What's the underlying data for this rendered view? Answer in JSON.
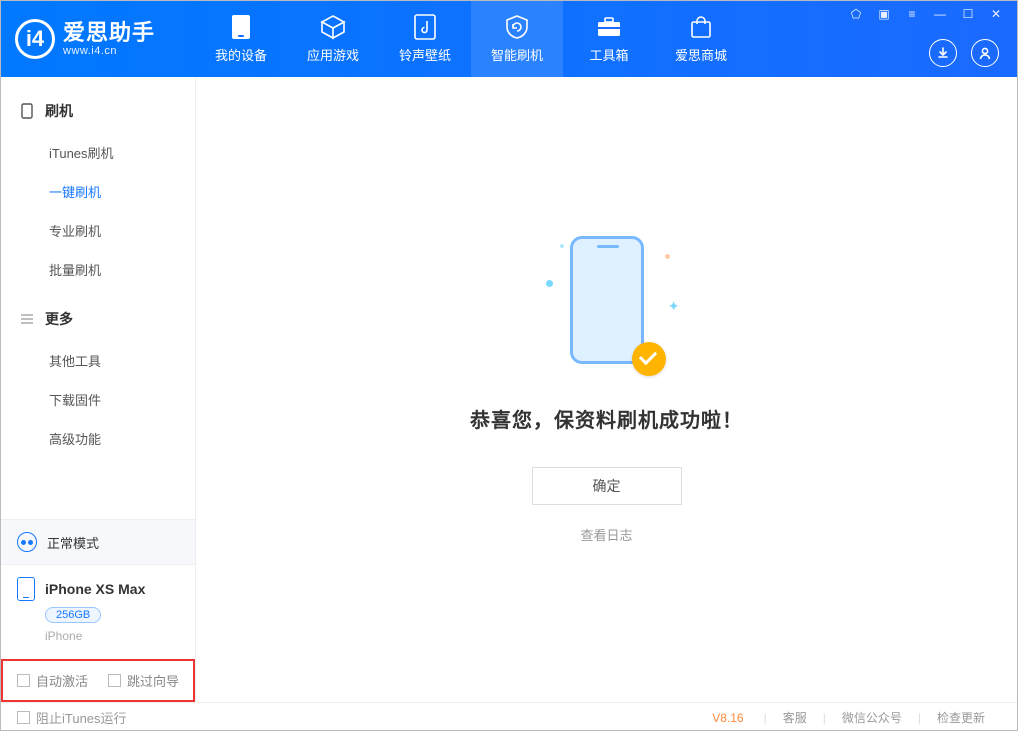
{
  "app": {
    "name": "爱思助手",
    "site": "www.i4.cn"
  },
  "tabs": [
    {
      "label": "我的设备"
    },
    {
      "label": "应用游戏"
    },
    {
      "label": "铃声壁纸"
    },
    {
      "label": "智能刷机"
    },
    {
      "label": "工具箱"
    },
    {
      "label": "爱思商城"
    }
  ],
  "active_tab_index": 3,
  "sidebar": {
    "sections": [
      {
        "title": "刷机",
        "items": [
          "iTunes刷机",
          "一键刷机",
          "专业刷机",
          "批量刷机"
        ],
        "active_index": 1
      },
      {
        "title": "更多",
        "items": [
          "其他工具",
          "下载固件",
          "高级功能"
        ]
      }
    ],
    "mode_label": "正常模式",
    "device": {
      "name": "iPhone XS Max",
      "capacity": "256GB",
      "type": "iPhone"
    },
    "extras": {
      "auto_activate": "自动激活",
      "skip_guide": "跳过向导"
    }
  },
  "main": {
    "success_title": "恭喜您，保资料刷机成功啦！",
    "ok": "确定",
    "view_log": "查看日志"
  },
  "footer": {
    "block_itunes": "阻止iTunes运行",
    "version": "V8.16",
    "links": [
      "客服",
      "微信公众号",
      "检查更新"
    ]
  }
}
